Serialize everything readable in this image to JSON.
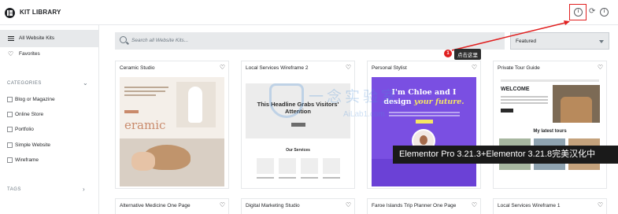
{
  "header": {
    "title": "KIT LIBRARY",
    "help_icon": "info-icon",
    "sync_icon": "refresh-icon",
    "info_icon": "info-icon"
  },
  "sidebar": {
    "all_label": "All Website Kits",
    "favorites_label": "Favorites",
    "categories_heading": "CATEGORIES",
    "categories": [
      "Blog or Magazine",
      "Online Store",
      "Portfolio",
      "Simple Website",
      "Wireframe"
    ],
    "tags_heading": "TAGS"
  },
  "search": {
    "placeholder": "Search all Website Kits..."
  },
  "sort": {
    "value": "Featured"
  },
  "annotation": {
    "step_number": "1",
    "tip_text": "点击这里"
  },
  "cards": [
    {
      "title": "Ceramic Studio",
      "thumb_word": "eramic"
    },
    {
      "title": "Local Services Wireframe 2",
      "hero_text": "This Headline Grabs Visitors' Attention",
      "section_text": "Our Services"
    },
    {
      "title": "Personal Stylist",
      "hero_line1": "I'm Chloe and I",
      "hero_line2": "design",
      "hero_line3": "your future."
    },
    {
      "title": "Private Tour Guide",
      "welcome": "WELCOME",
      "tours_heading": "My latest tours"
    },
    {
      "title": "Alternative Medicine One Page"
    },
    {
      "title": "Digital Marketing Studio"
    },
    {
      "title": "Faroe Islands Trip Planner One Page"
    },
    {
      "title": "Local Services Wireframe 1"
    }
  ],
  "watermark": {
    "text": "一念实验室",
    "sub": "AiLab1.com"
  },
  "overlay_text": "Elementor Pro 3.21.3+Elementor 3.21.8完美汉化中",
  "colors": {
    "highlight_red": "#e02020",
    "stylist_purple": "#7a4fe2",
    "ceramic_accent": "#c98a6b"
  }
}
